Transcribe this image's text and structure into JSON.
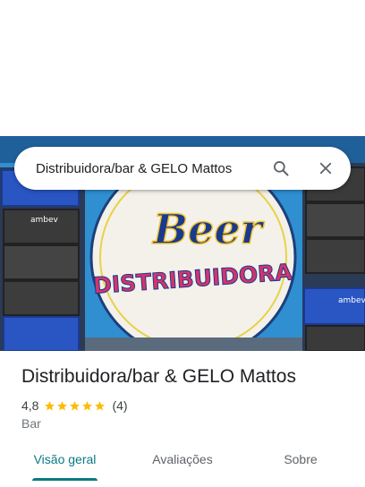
{
  "search": {
    "query": "Distribuidora/bar & GELO Mattos",
    "search_icon": "search-icon",
    "close_icon": "close-icon"
  },
  "hero": {
    "sign_line1": "Beer",
    "sign_line2": "DISTRIBUIDORA",
    "crate_brand": "ambev"
  },
  "place": {
    "name": "Distribuidora/bar & GELO Mattos",
    "rating": "4,8",
    "rating_value": 4.8,
    "stars_max": 5,
    "review_count": "(4)",
    "category": "Bar"
  },
  "tabs": [
    {
      "label": "Visão geral",
      "active": true
    },
    {
      "label": "Avaliações",
      "active": false
    },
    {
      "label": "Sobre",
      "active": false
    }
  ],
  "colors": {
    "accent": "#0b7a82",
    "star": "#fbbc04",
    "wall_blue": "#2f8fd1"
  }
}
